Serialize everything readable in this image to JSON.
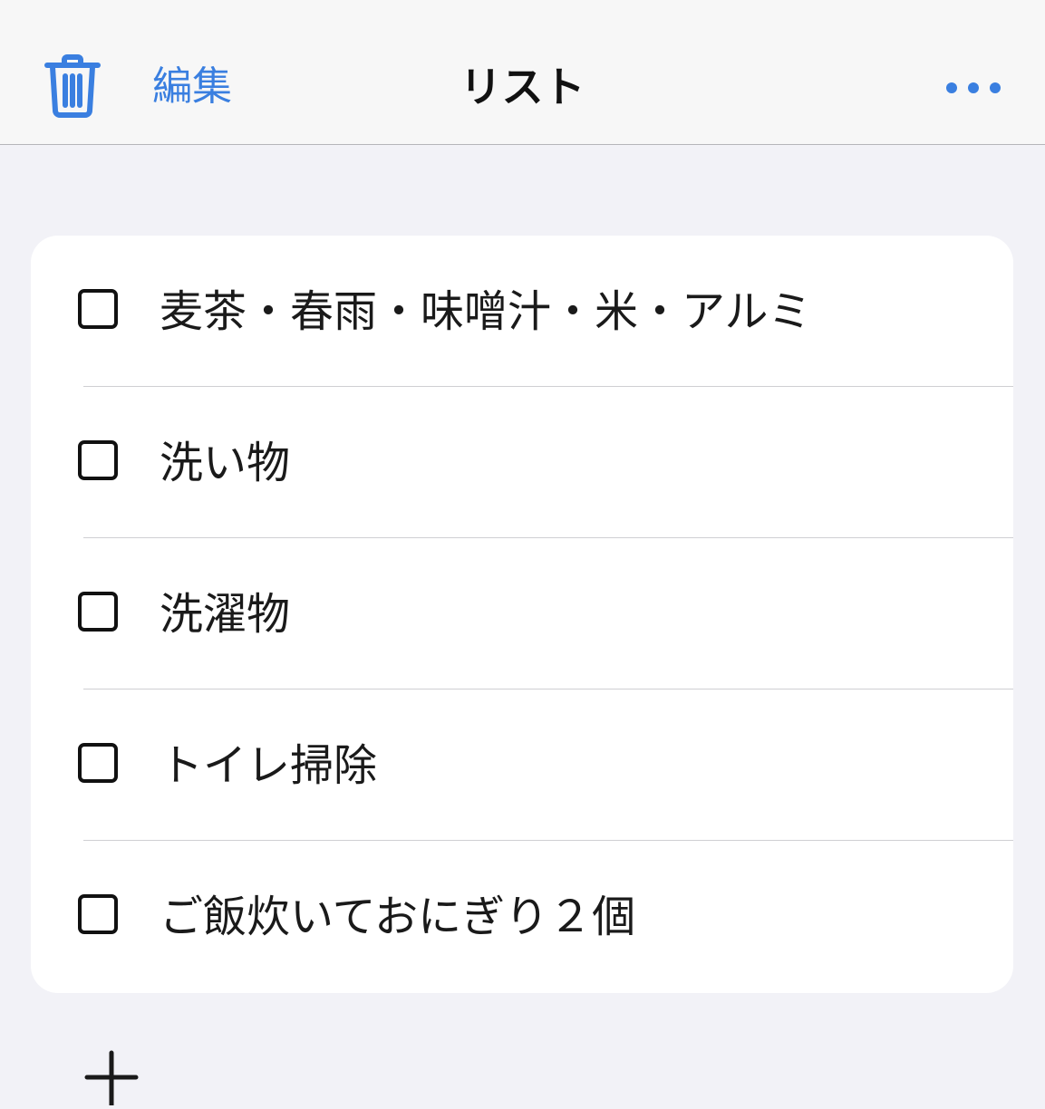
{
  "colors": {
    "accent": "#3a7fe0",
    "background": "#f2f2f7",
    "card": "#ffffff",
    "text": "#1a1a1a"
  },
  "navbar": {
    "delete_icon": "trash-icon",
    "edit_label": "編集",
    "title": "リスト",
    "more_icon": "ellipsis-icon"
  },
  "tasks": [
    {
      "label": "麦茶・春雨・味噌汁・米・アルミ",
      "checked": false
    },
    {
      "label": "洗い物",
      "checked": false
    },
    {
      "label": "洗濯物",
      "checked": false
    },
    {
      "label": "トイレ掃除",
      "checked": false
    },
    {
      "label": "ご飯炊いておにぎり２個",
      "checked": false
    }
  ],
  "footer": {
    "add_icon": "plus-icon"
  }
}
